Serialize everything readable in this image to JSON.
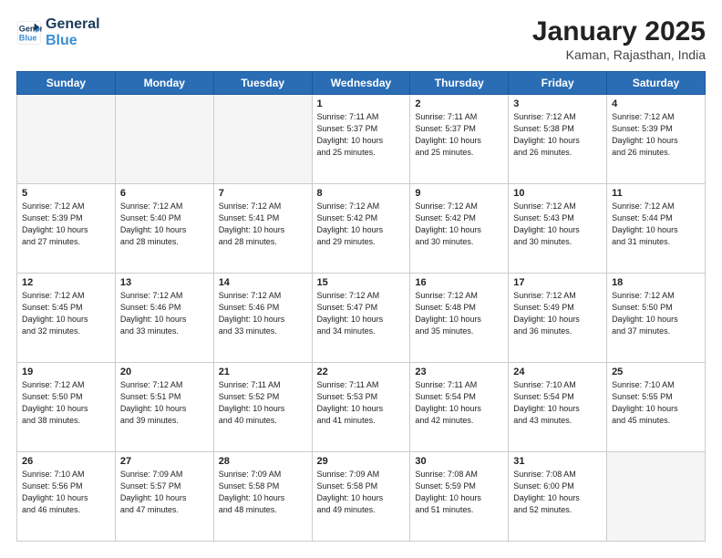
{
  "header": {
    "logo_line1": "General",
    "logo_line2": "Blue",
    "month": "January 2025",
    "location": "Kaman, Rajasthan, India"
  },
  "weekdays": [
    "Sunday",
    "Monday",
    "Tuesday",
    "Wednesday",
    "Thursday",
    "Friday",
    "Saturday"
  ],
  "weeks": [
    [
      {
        "day": "",
        "info": ""
      },
      {
        "day": "",
        "info": ""
      },
      {
        "day": "",
        "info": ""
      },
      {
        "day": "1",
        "info": "Sunrise: 7:11 AM\nSunset: 5:37 PM\nDaylight: 10 hours\nand 25 minutes."
      },
      {
        "day": "2",
        "info": "Sunrise: 7:11 AM\nSunset: 5:37 PM\nDaylight: 10 hours\nand 25 minutes."
      },
      {
        "day": "3",
        "info": "Sunrise: 7:12 AM\nSunset: 5:38 PM\nDaylight: 10 hours\nand 26 minutes."
      },
      {
        "day": "4",
        "info": "Sunrise: 7:12 AM\nSunset: 5:39 PM\nDaylight: 10 hours\nand 26 minutes."
      }
    ],
    [
      {
        "day": "5",
        "info": "Sunrise: 7:12 AM\nSunset: 5:39 PM\nDaylight: 10 hours\nand 27 minutes."
      },
      {
        "day": "6",
        "info": "Sunrise: 7:12 AM\nSunset: 5:40 PM\nDaylight: 10 hours\nand 28 minutes."
      },
      {
        "day": "7",
        "info": "Sunrise: 7:12 AM\nSunset: 5:41 PM\nDaylight: 10 hours\nand 28 minutes."
      },
      {
        "day": "8",
        "info": "Sunrise: 7:12 AM\nSunset: 5:42 PM\nDaylight: 10 hours\nand 29 minutes."
      },
      {
        "day": "9",
        "info": "Sunrise: 7:12 AM\nSunset: 5:42 PM\nDaylight: 10 hours\nand 30 minutes."
      },
      {
        "day": "10",
        "info": "Sunrise: 7:12 AM\nSunset: 5:43 PM\nDaylight: 10 hours\nand 30 minutes."
      },
      {
        "day": "11",
        "info": "Sunrise: 7:12 AM\nSunset: 5:44 PM\nDaylight: 10 hours\nand 31 minutes."
      }
    ],
    [
      {
        "day": "12",
        "info": "Sunrise: 7:12 AM\nSunset: 5:45 PM\nDaylight: 10 hours\nand 32 minutes."
      },
      {
        "day": "13",
        "info": "Sunrise: 7:12 AM\nSunset: 5:46 PM\nDaylight: 10 hours\nand 33 minutes."
      },
      {
        "day": "14",
        "info": "Sunrise: 7:12 AM\nSunset: 5:46 PM\nDaylight: 10 hours\nand 33 minutes."
      },
      {
        "day": "15",
        "info": "Sunrise: 7:12 AM\nSunset: 5:47 PM\nDaylight: 10 hours\nand 34 minutes."
      },
      {
        "day": "16",
        "info": "Sunrise: 7:12 AM\nSunset: 5:48 PM\nDaylight: 10 hours\nand 35 minutes."
      },
      {
        "day": "17",
        "info": "Sunrise: 7:12 AM\nSunset: 5:49 PM\nDaylight: 10 hours\nand 36 minutes."
      },
      {
        "day": "18",
        "info": "Sunrise: 7:12 AM\nSunset: 5:50 PM\nDaylight: 10 hours\nand 37 minutes."
      }
    ],
    [
      {
        "day": "19",
        "info": "Sunrise: 7:12 AM\nSunset: 5:50 PM\nDaylight: 10 hours\nand 38 minutes."
      },
      {
        "day": "20",
        "info": "Sunrise: 7:12 AM\nSunset: 5:51 PM\nDaylight: 10 hours\nand 39 minutes."
      },
      {
        "day": "21",
        "info": "Sunrise: 7:11 AM\nSunset: 5:52 PM\nDaylight: 10 hours\nand 40 minutes."
      },
      {
        "day": "22",
        "info": "Sunrise: 7:11 AM\nSunset: 5:53 PM\nDaylight: 10 hours\nand 41 minutes."
      },
      {
        "day": "23",
        "info": "Sunrise: 7:11 AM\nSunset: 5:54 PM\nDaylight: 10 hours\nand 42 minutes."
      },
      {
        "day": "24",
        "info": "Sunrise: 7:10 AM\nSunset: 5:54 PM\nDaylight: 10 hours\nand 43 minutes."
      },
      {
        "day": "25",
        "info": "Sunrise: 7:10 AM\nSunset: 5:55 PM\nDaylight: 10 hours\nand 45 minutes."
      }
    ],
    [
      {
        "day": "26",
        "info": "Sunrise: 7:10 AM\nSunset: 5:56 PM\nDaylight: 10 hours\nand 46 minutes."
      },
      {
        "day": "27",
        "info": "Sunrise: 7:09 AM\nSunset: 5:57 PM\nDaylight: 10 hours\nand 47 minutes."
      },
      {
        "day": "28",
        "info": "Sunrise: 7:09 AM\nSunset: 5:58 PM\nDaylight: 10 hours\nand 48 minutes."
      },
      {
        "day": "29",
        "info": "Sunrise: 7:09 AM\nSunset: 5:58 PM\nDaylight: 10 hours\nand 49 minutes."
      },
      {
        "day": "30",
        "info": "Sunrise: 7:08 AM\nSunset: 5:59 PM\nDaylight: 10 hours\nand 51 minutes."
      },
      {
        "day": "31",
        "info": "Sunrise: 7:08 AM\nSunset: 6:00 PM\nDaylight: 10 hours\nand 52 minutes."
      },
      {
        "day": "",
        "info": ""
      }
    ]
  ]
}
